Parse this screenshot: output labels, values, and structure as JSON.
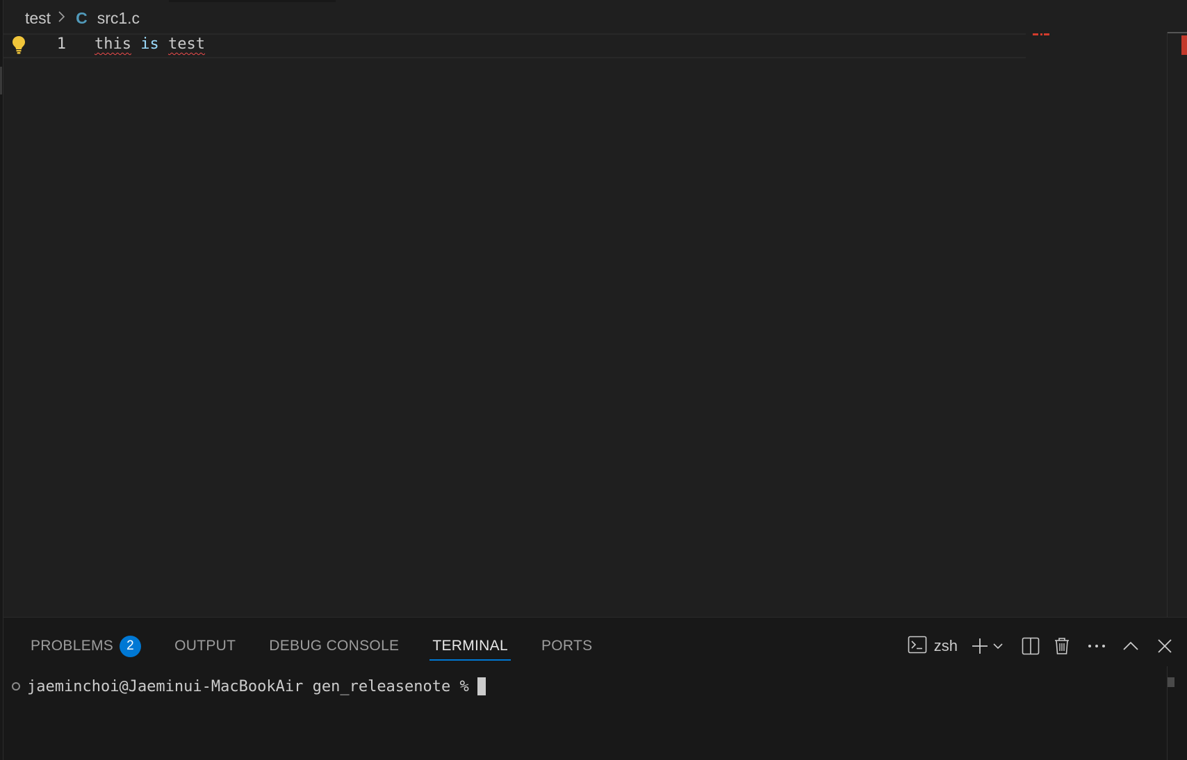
{
  "breadcrumb": {
    "folder": "test",
    "file_icon": "C",
    "file": "src1.c"
  },
  "editor": {
    "line_number": "1",
    "tokens": [
      "this",
      "is",
      "test"
    ],
    "lightbulb_icon": "lightbulb-icon",
    "error_color": "#f14c4c"
  },
  "panel": {
    "tabs": [
      {
        "label": "PROBLEMS",
        "badge": "2"
      },
      {
        "label": "OUTPUT"
      },
      {
        "label": "DEBUG CONSOLE"
      },
      {
        "label": "TERMINAL",
        "active": true
      },
      {
        "label": "PORTS"
      }
    ],
    "shell": "zsh",
    "accent_color": "#0078d4",
    "actions": [
      "terminal-icon",
      "plus-icon",
      "chevron-down-icon",
      "split-icon",
      "trash-icon",
      "more-icon",
      "chevron-up-icon",
      "close-icon"
    ]
  },
  "terminal": {
    "prompt": "jaeminchoi@Jaeminui-MacBookAir gen_releasenote %"
  }
}
